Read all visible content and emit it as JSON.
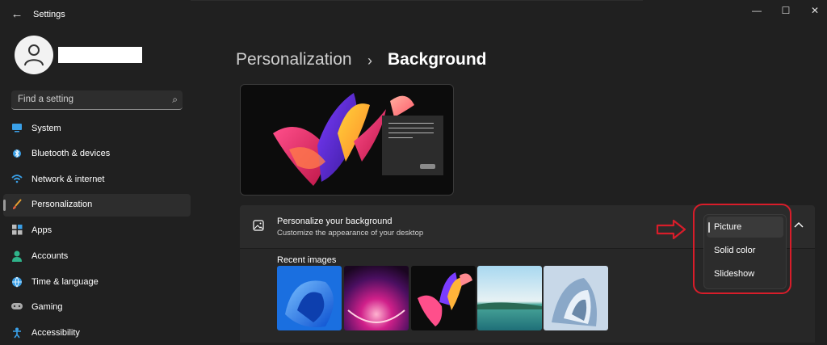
{
  "window": {
    "title": "Settings",
    "back_glyph": "←",
    "minimize_glyph": "—",
    "maximize_glyph": "☐",
    "close_glyph": "✕"
  },
  "user": {
    "name": ""
  },
  "search": {
    "placeholder": "Find a setting",
    "value": "",
    "icon": "search-icon"
  },
  "sidebar": {
    "items": [
      {
        "label": "System",
        "icon": "system-icon",
        "active": false
      },
      {
        "label": "Bluetooth & devices",
        "icon": "bluetooth-icon",
        "active": false
      },
      {
        "label": "Network & internet",
        "icon": "wifi-icon",
        "active": false
      },
      {
        "label": "Personalization",
        "icon": "brush-icon",
        "active": true
      },
      {
        "label": "Apps",
        "icon": "apps-icon",
        "active": false
      },
      {
        "label": "Accounts",
        "icon": "person-icon",
        "active": false
      },
      {
        "label": "Time & language",
        "icon": "globe-icon",
        "active": false
      },
      {
        "label": "Gaming",
        "icon": "gamepad-icon",
        "active": false
      },
      {
        "label": "Accessibility",
        "icon": "accessibility-icon",
        "active": false
      }
    ]
  },
  "breadcrumb": {
    "parent": "Personalization",
    "separator": "›",
    "current": "Background"
  },
  "background_panel": {
    "title": "Personalize your background",
    "subtitle": "Customize the appearance of your desktop",
    "recent_label": "Recent images",
    "expanded": true
  },
  "dropdown": {
    "selected": "Picture",
    "options": [
      "Picture",
      "Solid color",
      "Slideshow"
    ]
  },
  "colors": {
    "background": "#202020",
    "panel": "#2b2b2b",
    "annotation_red": "#d81d2a"
  }
}
